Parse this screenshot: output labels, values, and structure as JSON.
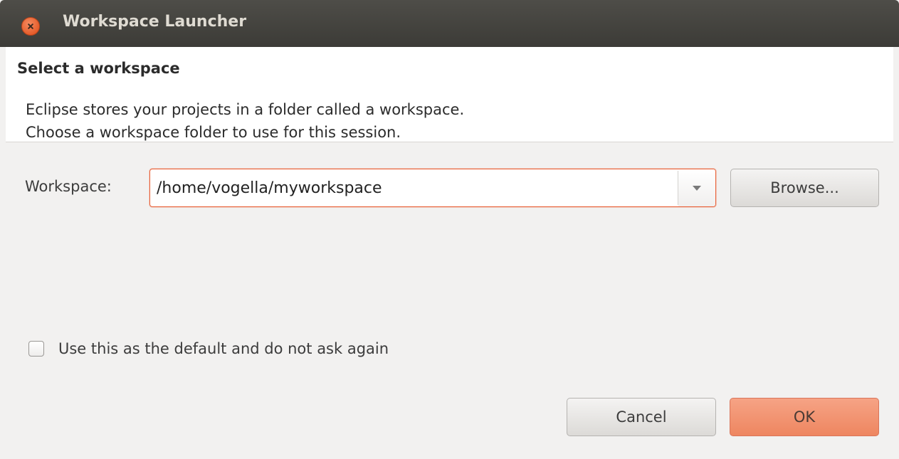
{
  "window": {
    "title": "Workspace Launcher"
  },
  "header": {
    "title": "Select a workspace",
    "description_line1": "Eclipse stores your projects in a folder called a workspace.",
    "description_line2": "Choose a workspace folder to use for this session."
  },
  "workspace": {
    "label": "Workspace:",
    "value": "/home/vogella/myworkspace",
    "browse_label": "Browse..."
  },
  "options": {
    "default_label": "Use this as the default and do not ask again",
    "default_checked": false
  },
  "actions": {
    "cancel_label": "Cancel",
    "ok_label": "OK"
  },
  "icons": {
    "close": "close-icon",
    "dropdown": "chevron-down-icon"
  },
  "colors": {
    "titlebar": "#3c3b37",
    "accent": "#e9633a",
    "ok_button": "#ee8660"
  }
}
